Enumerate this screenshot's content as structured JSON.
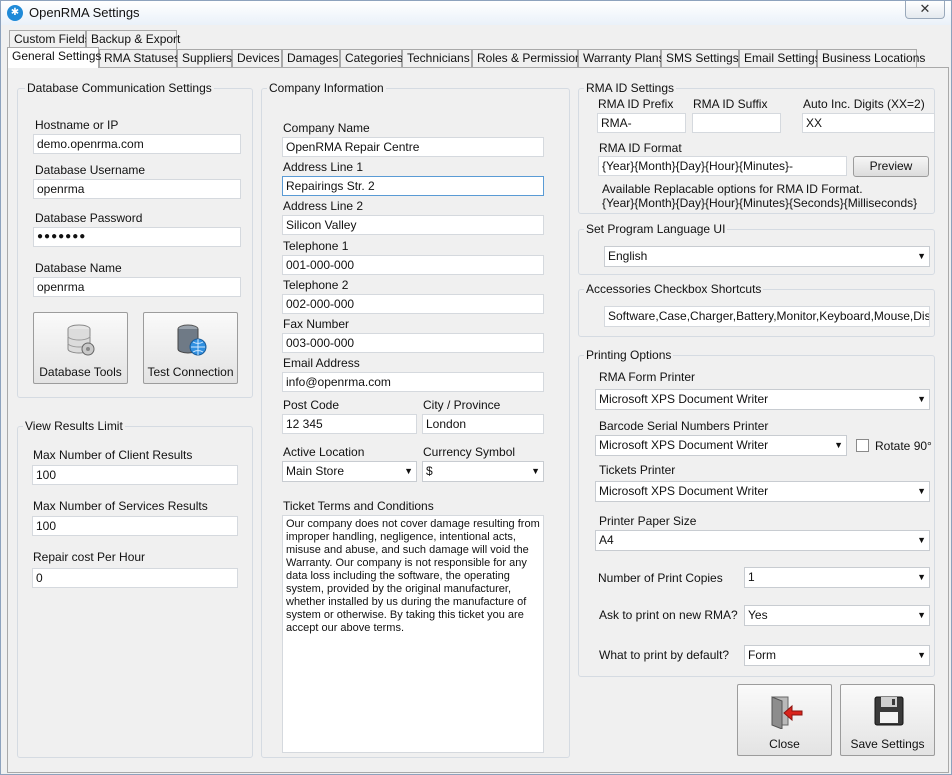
{
  "window": {
    "title": "OpenRMA Settings",
    "close_glyph": "✕"
  },
  "tabs_row1": [
    "Custom Fields",
    "Backup & Export"
  ],
  "tabs_row2": [
    "General Settings",
    "RMA Statuses",
    "Suppliers",
    "Devices",
    "Damages",
    "Categories",
    "Technicians",
    "Roles & Permissions",
    "Warranty Plans",
    "SMS Settings",
    "Email Settings",
    "Business Locations"
  ],
  "database": {
    "group_title": "Database Communication Settings",
    "host_label": "Hostname or IP",
    "host_value": "demo.openrma.com",
    "user_label": "Database Username",
    "user_value": "openrma",
    "pass_label": "Database Password",
    "pass_value": "●●●●●●●",
    "name_label": "Database Name",
    "name_value": "openrma",
    "tools_button": "Database Tools",
    "test_button": "Test Connection"
  },
  "view_results": {
    "group_title": "View Results Limit",
    "client_label": "Max Number of Client Results",
    "client_value": "100",
    "services_label": "Max Number of Services Results",
    "services_value": "100",
    "repair_label": "Repair cost Per Hour",
    "repair_value": "0"
  },
  "company": {
    "group_title": "Company Information",
    "name_label": "Company Name",
    "name_value": "OpenRMA Repair Centre",
    "addr1_label": "Address Line 1",
    "addr1_value": "Repairings Str. 2",
    "addr2_label": "Address Line 2",
    "addr2_value": "Silicon Valley",
    "tel1_label": "Telephone 1",
    "tel1_value": "001-000-000",
    "tel2_label": "Telephone 2",
    "tel2_value": "002-000-000",
    "fax_label": "Fax Number",
    "fax_value": "003-000-000",
    "email_label": "Email Address",
    "email_value": "info@openrma.com",
    "post_label": "Post Code",
    "post_value": "12 345",
    "city_label": "City / Province",
    "city_value": "London",
    "location_label": "Active Location",
    "location_value": "Main Store",
    "currency_label": "Currency Symbol",
    "currency_value": "$",
    "terms_label": "Ticket Terms and Conditions",
    "terms_value": "Our company does not cover damage resulting from improper handling, negligence, intentional acts, misuse and abuse, and such damage will void the Warranty. Our company is not responsible for any data loss including the software, the operating system, provided by the original manufacturer, whether installed by us during the manufacture of system or otherwise. By taking this ticket you are accept our above terms."
  },
  "rma_id": {
    "group_title": "RMA ID Settings",
    "prefix_label": "RMA ID Prefix",
    "prefix_value": "RMA-",
    "suffix_label": "RMA ID Suffix",
    "suffix_value": "",
    "digits_label": "Auto Inc. Digits (XX=2)",
    "digits_value": "XX",
    "format_label": "RMA ID Format",
    "format_value": "{Year}{Month}{Day}{Hour}{Minutes}-",
    "preview_button": "Preview",
    "hint_line1": "Available Replacable options for RMA ID Format.",
    "hint_line2": "{Year}{Month}{Day}{Hour}{Minutes}{Seconds}{Milliseconds}"
  },
  "language": {
    "group_title": "Set Program Language UI",
    "value": "English"
  },
  "accessories": {
    "group_title": "Accessories Checkbox Shortcuts",
    "value": "Software,Case,Charger,Battery,Monitor,Keyboard,Mouse,Display,Po"
  },
  "printing": {
    "group_title": "Printing Options",
    "rma_printer_label": "RMA Form Printer",
    "rma_printer_value": "Microsoft XPS Document Writer",
    "barcode_label": "Barcode Serial Numbers Printer",
    "barcode_value": "Microsoft XPS Document Writer",
    "rotate_label": "Rotate 90°",
    "tickets_label": "Tickets Printer",
    "tickets_value": "Microsoft XPS Document Writer",
    "paper_label": "Printer Paper Size",
    "paper_value": "A4",
    "copies_label": "Number of Print Copies",
    "copies_value": "1",
    "ask_label": "Ask to print on new RMA?",
    "ask_value": "Yes",
    "default_label": "What to print  by default?",
    "default_value": "Form"
  },
  "actions": {
    "close_button": "Close",
    "save_button": "Save Settings"
  },
  "arrow_glyph": "▼"
}
